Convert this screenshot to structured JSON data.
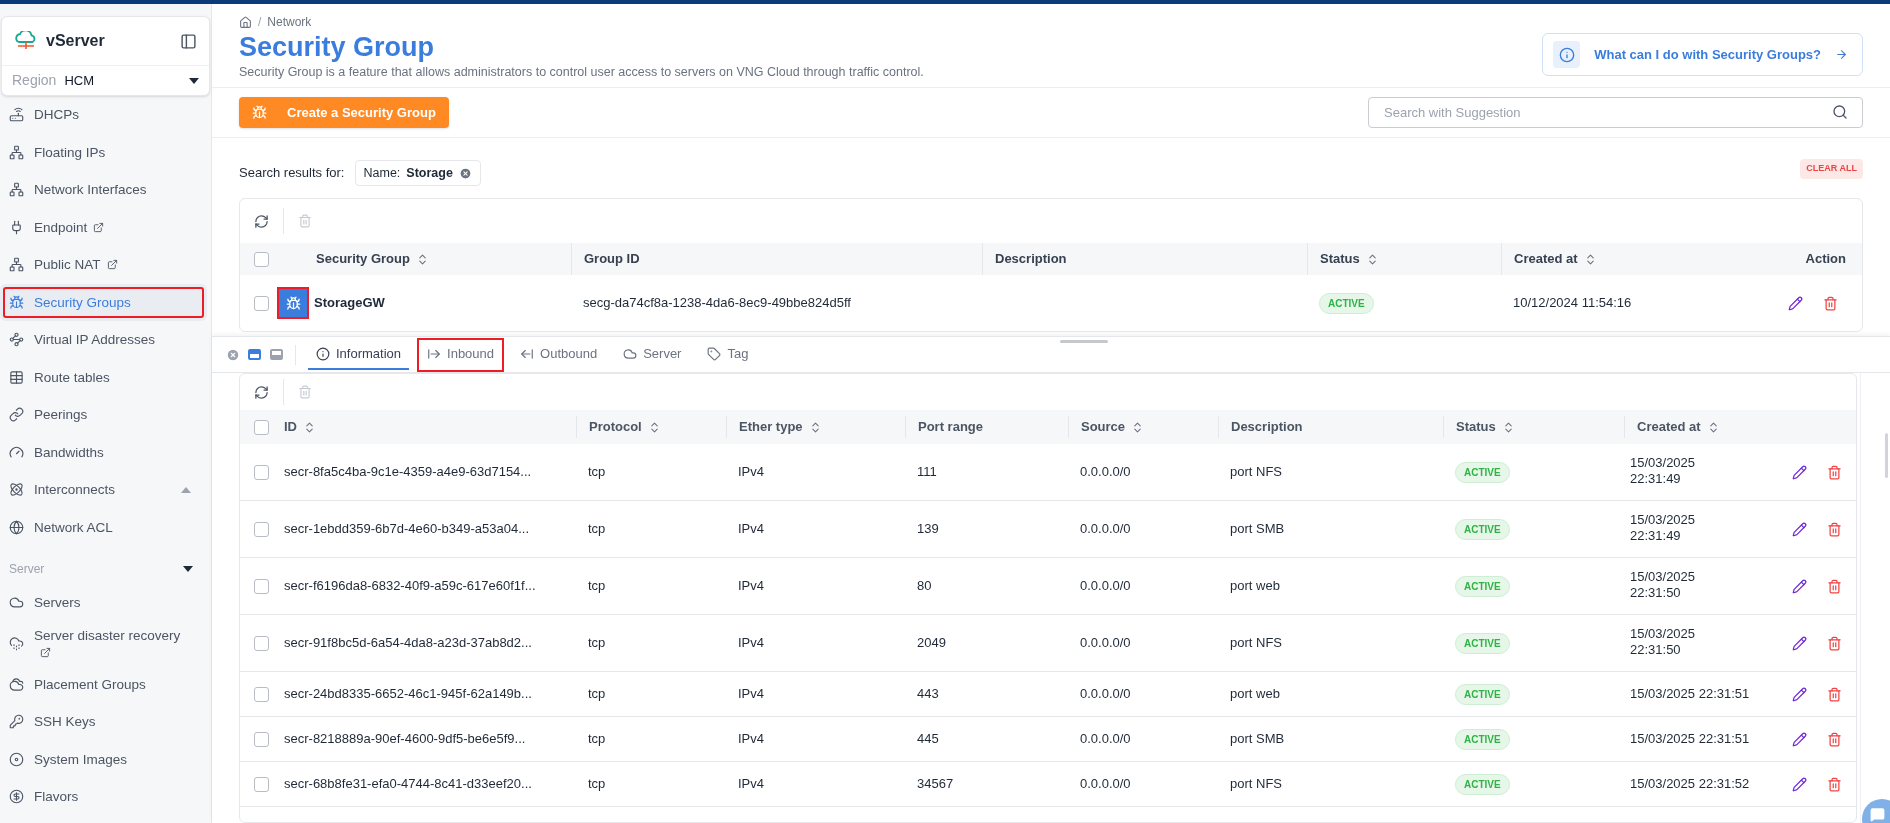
{
  "app": {
    "name": "vServer",
    "region_label": "Region",
    "region": "HCM"
  },
  "sidebar": {
    "groups": [
      {
        "items": [
          {
            "label": "DHCPs",
            "selected": false,
            "external": false
          },
          {
            "label": "Floating IPs",
            "selected": false,
            "external": false
          },
          {
            "label": "Network Interfaces",
            "selected": false,
            "external": false
          },
          {
            "label": "Endpoint",
            "selected": false,
            "external": true
          },
          {
            "label": "Public NAT",
            "selected": false,
            "external": true
          },
          {
            "label": "Security Groups",
            "selected": true,
            "external": false,
            "annotated": true
          },
          {
            "label": "Virtual IP Addresses",
            "selected": false,
            "external": false
          },
          {
            "label": "Route tables",
            "selected": false,
            "external": false
          },
          {
            "label": "Peerings",
            "selected": false,
            "external": false
          },
          {
            "label": "Bandwidths",
            "selected": false,
            "external": false
          },
          {
            "label": "Interconnects",
            "selected": false,
            "external": false,
            "expanded": false
          },
          {
            "label": "Network ACL",
            "selected": false,
            "external": false
          }
        ]
      },
      {
        "title": "Server",
        "expanded": true,
        "items": [
          {
            "label": "Servers",
            "selected": false,
            "external": false
          },
          {
            "label": "Server disaster recovery",
            "selected": false,
            "external": true
          },
          {
            "label": "Placement Groups",
            "selected": false,
            "external": false
          },
          {
            "label": "SSH Keys",
            "selected": false,
            "external": false
          },
          {
            "label": "System Images",
            "selected": false,
            "external": false
          },
          {
            "label": "Flavors",
            "selected": false,
            "external": false
          }
        ]
      }
    ]
  },
  "header": {
    "breadcrumb_separator": "/",
    "breadcrumb": "Network",
    "title": "Security Group",
    "description": "Security Group is a feature that allows administrators to control user access to servers on VNG Cloud through traffic control.",
    "help_link": "What can I do with Security Groups?"
  },
  "toolbar": {
    "create_button": "Create a Security Group",
    "search": {
      "placeholder": "Search with Suggestion"
    }
  },
  "filters": {
    "label": "Search results for:",
    "chips": [
      {
        "key": "Name:",
        "value": "Storage"
      }
    ],
    "clear_all": "CLEAR ALL"
  },
  "groups_table": {
    "header_checked": false,
    "columns": [
      {
        "label": "Security Group",
        "sortable": true
      },
      {
        "label": "Group ID",
        "sortable": false
      },
      {
        "label": "Description",
        "sortable": false
      },
      {
        "label": "Status",
        "sortable": true
      },
      {
        "label": "Created at",
        "sortable": true
      },
      {
        "label": "Action",
        "sortable": false
      }
    ],
    "rows": [
      {
        "checked": false,
        "annotated": true,
        "name": "StorageGW",
        "group_id": "secg-da74cf8a-1238-4da6-8ec9-49bbe824d5ff",
        "status": "ACTIVE",
        "created_at": "10/12/2024 11:54:16"
      }
    ]
  },
  "detail_panel": {
    "tabs": [
      {
        "label": "Information",
        "selected": true,
        "annotated": false
      },
      {
        "label": "Inbound",
        "selected": false,
        "annotated": true
      },
      {
        "label": "Outbound",
        "selected": false,
        "annotated": false
      },
      {
        "label": "Server",
        "selected": false,
        "annotated": false
      },
      {
        "label": "Tag",
        "selected": false,
        "annotated": false
      }
    ],
    "rules_table": {
      "header_checked": false,
      "columns": [
        {
          "label": "ID",
          "sortable": true
        },
        {
          "label": "Protocol",
          "sortable": true
        },
        {
          "label": "Ether type",
          "sortable": true
        },
        {
          "label": "Port range",
          "sortable": false
        },
        {
          "label": "Source",
          "sortable": true
        },
        {
          "label": "Description",
          "sortable": false
        },
        {
          "label": "Status",
          "sortable": true
        },
        {
          "label": "Created at",
          "sortable": true
        }
      ],
      "rows": [
        {
          "checked": false,
          "id": "secr-8fa5c4ba-9c1e-4359-a4e9-63d7154...",
          "protocol": "tcp",
          "ether_type": "IPv4",
          "port_range": "111",
          "source": "0.0.0.0/0",
          "description": "port NFS",
          "status": "ACTIVE",
          "created_at": "15/03/2025 22:31:49",
          "wrapped": true
        },
        {
          "checked": false,
          "id": "secr-1ebdd359-6b7d-4e60-b349-a53a04...",
          "protocol": "tcp",
          "ether_type": "IPv4",
          "port_range": "139",
          "source": "0.0.0.0/0",
          "description": "port SMB",
          "status": "ACTIVE",
          "created_at": "15/03/2025 22:31:49",
          "wrapped": true
        },
        {
          "checked": false,
          "id": "secr-f6196da8-6832-40f9-a59c-617e60f1f...",
          "protocol": "tcp",
          "ether_type": "IPv4",
          "port_range": "80",
          "source": "0.0.0.0/0",
          "description": "port web",
          "status": "ACTIVE",
          "created_at": "15/03/2025 22:31:50",
          "wrapped": true
        },
        {
          "checked": false,
          "id": "secr-91f8bc5d-6a54-4da8-a23d-37ab8d2...",
          "protocol": "tcp",
          "ether_type": "IPv4",
          "port_range": "2049",
          "source": "0.0.0.0/0",
          "description": "port NFS",
          "status": "ACTIVE",
          "created_at": "15/03/2025 22:31:50",
          "wrapped": true
        },
        {
          "checked": false,
          "id": "secr-24bd8335-6652-46c1-945f-62a149b...",
          "protocol": "tcp",
          "ether_type": "IPv4",
          "port_range": "443",
          "source": "0.0.0.0/0",
          "description": "port web",
          "status": "ACTIVE",
          "created_at": "15/03/2025 22:31:51",
          "wrapped": false
        },
        {
          "checked": false,
          "id": "secr-8218889a-90ef-4600-9df5-be6e5f9...",
          "protocol": "tcp",
          "ether_type": "IPv4",
          "port_range": "445",
          "source": "0.0.0.0/0",
          "description": "port SMB",
          "status": "ACTIVE",
          "created_at": "15/03/2025 22:31:51",
          "wrapped": false
        },
        {
          "checked": false,
          "id": "secr-68b8fe31-efa0-4744-8c41-d33eef20...",
          "protocol": "tcp",
          "ether_type": "IPv4",
          "port_range": "34567",
          "source": "0.0.0.0/0",
          "description": "port NFS",
          "status": "ACTIVE",
          "created_at": "15/03/2025 22:31:52",
          "wrapped": false
        }
      ]
    }
  }
}
